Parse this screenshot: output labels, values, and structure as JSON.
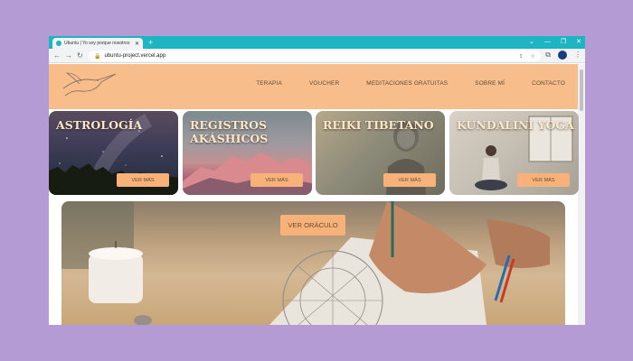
{
  "browser": {
    "tab_title": "Ubuntu | Yo soy porque nosotros",
    "url": "ubuntu-project.vercel.app",
    "icons": {
      "back": "arrow-left-icon",
      "forward": "arrow-right-icon",
      "reload": "reload-icon",
      "lock": "lock-icon",
      "new_tab": "plus-icon",
      "menu": "kebab-menu-icon"
    }
  },
  "site": {
    "brand_colors": {
      "header": "#f7bd8a",
      "button": "#f7b27a",
      "card_title": "#fde7c6"
    },
    "nav": [
      "TERAPIA",
      "VOUCHER",
      "MEDITACIONES GRATUITAS",
      "SOBRE MÍ",
      "CONTACTO"
    ],
    "cards": [
      {
        "title": "ASTROLOGÍA",
        "button": "VER MÁS"
      },
      {
        "title": "REGISTROS AKÁSHICOS",
        "button": "VER MÁS"
      },
      {
        "title": "REIKI TIBETANO",
        "button": "VER MÁS"
      },
      {
        "title": "KUNDALINI YOGA",
        "button": "VER MÁS"
      }
    ],
    "hero": {
      "button": "VER ORÁCULO"
    }
  }
}
